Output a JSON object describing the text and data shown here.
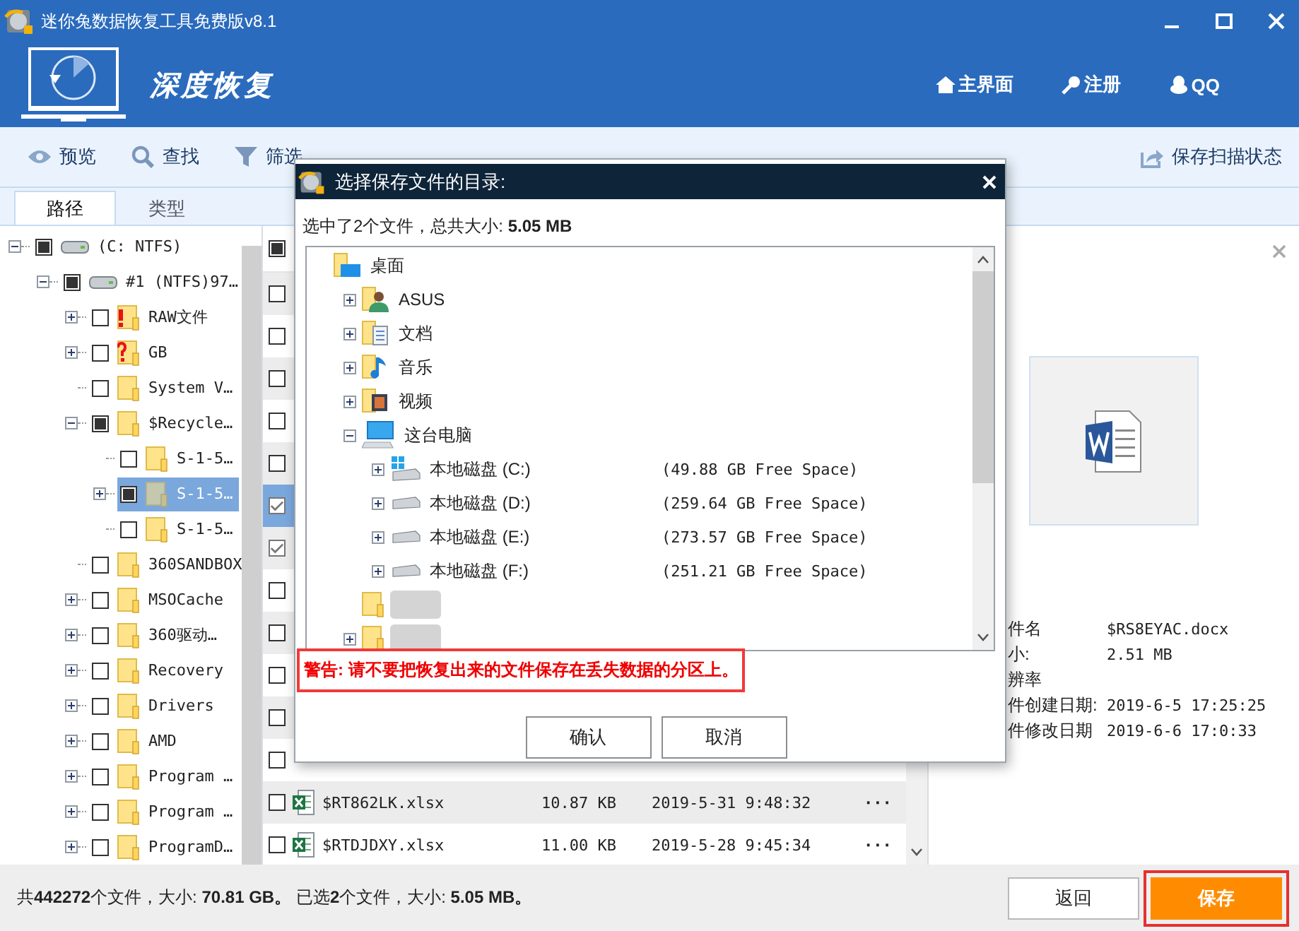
{
  "window": {
    "title": "迷你兔数据恢复工具免费版v8.1"
  },
  "header": {
    "brand": "深度恢复",
    "nav": [
      "主界面",
      "注册",
      "QQ"
    ]
  },
  "toolbar": {
    "tools": [
      "预览",
      "查找",
      "筛选"
    ],
    "save_scan": "保存扫描状态"
  },
  "tabs": [
    {
      "label": "路径",
      "selected": true
    },
    {
      "label": "类型",
      "selected": false
    }
  ],
  "tree": [
    {
      "label": "(C: NTFS)",
      "kind": "drive",
      "expandable": true,
      "expanded": true,
      "partial": true,
      "selected": false,
      "children": [
        {
          "label": "#1 (NTFS)97…",
          "kind": "drive",
          "expandable": true,
          "expanded": true,
          "partial": true,
          "selected": false,
          "children": [
            {
              "label": "RAW文件",
              "kind": "folder-alert",
              "expandable": true,
              "expanded": false,
              "partial": false,
              "selected": false
            },
            {
              "label": "GB",
              "kind": "folder-question",
              "expandable": true,
              "expanded": false,
              "partial": false,
              "selected": false
            },
            {
              "label": "System V…",
              "kind": "folder",
              "expandable": false,
              "partial": false,
              "selected": false
            },
            {
              "label": "$Recycle…",
              "kind": "folder",
              "expandable": true,
              "expanded": true,
              "partial": true,
              "selected": false,
              "children": [
                {
                  "label": "S-1-5…",
                  "kind": "folder",
                  "expandable": false,
                  "partial": false,
                  "selected": false
                },
                {
                  "label": "S-1-5…",
                  "kind": "folder",
                  "expandable": true,
                  "expanded": false,
                  "partial": true,
                  "selected": true
                },
                {
                  "label": "S-1-5…",
                  "kind": "folder",
                  "expandable": false,
                  "partial": false,
                  "selected": false
                }
              ]
            },
            {
              "label": "360SANDBOX",
              "kind": "folder",
              "expandable": false,
              "partial": false,
              "selected": false
            },
            {
              "label": "MSOCache",
              "kind": "folder",
              "expandable": true,
              "expanded": false,
              "partial": false,
              "selected": false
            },
            {
              "label": "360驱动…",
              "kind": "folder",
              "expandable": true,
              "expanded": false,
              "partial": false,
              "selected": false
            },
            {
              "label": "Recovery",
              "kind": "folder",
              "expandable": true,
              "expanded": false,
              "partial": false,
              "selected": false
            },
            {
              "label": "Drivers",
              "kind": "folder",
              "expandable": true,
              "expanded": false,
              "partial": false,
              "selected": false
            },
            {
              "label": "AMD",
              "kind": "folder",
              "expandable": true,
              "expanded": false,
              "partial": false,
              "selected": false
            },
            {
              "label": "Program …",
              "kind": "folder",
              "expandable": true,
              "expanded": false,
              "partial": false,
              "selected": false
            },
            {
              "label": "Program …",
              "kind": "folder",
              "expandable": true,
              "expanded": false,
              "partial": false,
              "selected": false
            },
            {
              "label": "ProgramD…",
              "kind": "folder",
              "expandable": true,
              "expanded": false,
              "partial": false,
              "selected": false
            }
          ]
        }
      ]
    }
  ],
  "file_list": {
    "all_partial": true,
    "rows": [
      {
        "checked": false,
        "selected": false
      },
      {
        "checked": false,
        "selected": false
      },
      {
        "checked": false,
        "selected": false
      },
      {
        "checked": false,
        "selected": false
      },
      {
        "checked": false,
        "selected": false
      },
      {
        "checked": true,
        "selected": true
      },
      {
        "checked": true,
        "selected": false
      },
      {
        "checked": false,
        "selected": false
      },
      {
        "checked": false,
        "selected": false
      },
      {
        "checked": false,
        "selected": false
      },
      {
        "checked": false,
        "selected": false
      },
      {
        "checked": false,
        "selected": false
      },
      {
        "checked": false,
        "selected": false,
        "name": "$RT862LK.xlsx",
        "size": "10.87 KB",
        "date": "2019-5-31 9:48:32",
        "more": "···"
      },
      {
        "checked": false,
        "selected": false,
        "name": "$RTDJDXY.xlsx",
        "size": "11.00 KB",
        "date": "2019-5-28 9:45:34",
        "more": "···"
      }
    ]
  },
  "preview": {
    "properties": [
      {
        "label": "件名",
        "value": "$RS8EYAC.docx"
      },
      {
        "label": "小:",
        "value": "2.51 MB"
      },
      {
        "label": "辨率"
      },
      {
        "label": "件创建日期:",
        "value": "2019-6-5 17:25:25"
      },
      {
        "label": "件修改日期",
        "value": "2019-6-6 17:0:33"
      }
    ]
  },
  "status_bar": {
    "text": "共**442272**个文件，大小: **70.81 GB。** 已选**2**个文件，大小: **5.05 MB。**",
    "buttons": [
      "返回",
      "保存"
    ]
  },
  "dialog": {
    "title": "选择保存文件的目录:",
    "info": "选中了2个文件，总共大小: **5.05 MB**",
    "tree": [
      {
        "label": "桌面",
        "kind": "desktop",
        "expandable": false,
        "children": [
          {
            "label": "ASUS",
            "kind": "user-folder",
            "expandable": true,
            "expanded": false
          },
          {
            "label": "文档",
            "kind": "docs-folder",
            "expandable": true,
            "expanded": false
          },
          {
            "label": "音乐",
            "kind": "music-folder",
            "expandable": true,
            "expanded": false
          },
          {
            "label": "视频",
            "kind": "video-folder",
            "expandable": true,
            "expanded": false
          },
          {
            "label": "这台电脑",
            "kind": "computer",
            "expandable": true,
            "expanded": true,
            "children": [
              {
                "label": "本地磁盘 (C:)",
                "free": "(49.88 GB Free Space)",
                "kind": "system-disk",
                "expandable": true,
                "expanded": false
              },
              {
                "label": "本地磁盘 (D:)",
                "free": "(259.64 GB Free Space)",
                "kind": "disk",
                "expandable": true,
                "expanded": false
              },
              {
                "label": "本地磁盘 (E:)",
                "free": "(273.57 GB Free Space)",
                "kind": "disk",
                "expandable": true,
                "expanded": false
              },
              {
                "label": "本地磁盘 (F:)",
                "free": "(251.21 GB Free Space)",
                "kind": "disk",
                "expandable": true,
                "expanded": false
              }
            ]
          },
          {
            "kind": "redacted-folder",
            "expandable": false
          },
          {
            "kind": "redacted-folder",
            "expandable": true,
            "expanded": false
          }
        ]
      }
    ],
    "warning": "**警告:** 请不要把恢复出来的文件保存在丢失数据的分区上。",
    "buttons": [
      "确认",
      "取消"
    ]
  }
}
